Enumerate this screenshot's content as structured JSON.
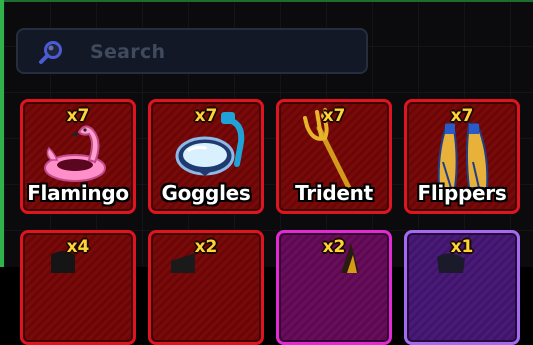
{
  "search": {
    "placeholder": "Search",
    "icon": "search-icon"
  },
  "inventory": {
    "items": [
      {
        "name": "Flamingo",
        "count": "x7",
        "rarity_color": "#e0141e",
        "icon": "flamingo-icon"
      },
      {
        "name": "Goggles",
        "count": "x7",
        "rarity_color": "#e0141e",
        "icon": "goggles-icon"
      },
      {
        "name": "Trident",
        "count": "x7",
        "rarity_color": "#e0141e",
        "icon": "trident-icon"
      },
      {
        "name": "Flippers",
        "count": "x7",
        "rarity_color": "#e0141e",
        "icon": "flippers-icon"
      },
      {
        "name": "",
        "count": "x4",
        "rarity_color": "#e0141e",
        "icon": "item-icon"
      },
      {
        "name": "",
        "count": "x2",
        "rarity_color": "#e0141e",
        "icon": "item-icon"
      },
      {
        "name": "",
        "count": "x2",
        "rarity_color": "#e12ad1",
        "icon": "item-icon"
      },
      {
        "name": "",
        "count": "x1",
        "rarity_color": "#a66af0",
        "icon": "item-icon"
      }
    ]
  }
}
